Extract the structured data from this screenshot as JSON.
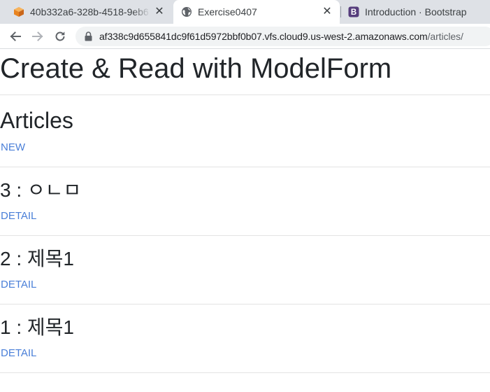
{
  "browser": {
    "tabs": [
      {
        "title": "40b332a6-328b-4518-9eb6",
        "icon": "cube-icon",
        "active": false
      },
      {
        "title": "Exercise0407",
        "icon": "globe-icon",
        "active": true
      },
      {
        "title": "Introduction · Bootstrap",
        "icon": "bootstrap-icon",
        "active": false
      }
    ],
    "bootstrap_letter": "B",
    "close_glyph": "✕",
    "address": {
      "host": "af338c9d655841dc9f61d5972bbf0b07.vfs.cloud9.us-west-2.amazonaws.com",
      "path": "/articles/"
    },
    "colors": {
      "tabstrip": "#dee1e6",
      "omnibox": "#f1f3f4",
      "bootstrap_purple": "#563d7c",
      "cloud9_orange": "#f29a33"
    }
  },
  "page": {
    "title": "Create & Read with ModelForm",
    "section_title": "Articles",
    "new_link": "NEW",
    "link_color": "#4a7fd8",
    "articles": [
      {
        "heading": "3 : ㅇㄴㅁ",
        "link": "DETAIL"
      },
      {
        "heading": "2 : 제목1",
        "link": "DETAIL"
      },
      {
        "heading": "1 : 제목1",
        "link": "DETAIL"
      }
    ]
  }
}
